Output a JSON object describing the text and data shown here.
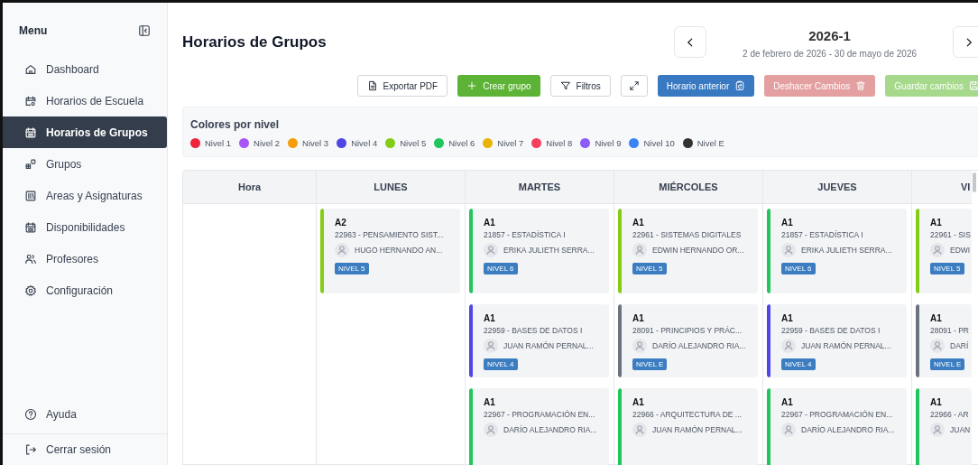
{
  "sidebar": {
    "title": "Menu",
    "items": [
      {
        "label": "Dashboard",
        "selected": false
      },
      {
        "label": "Horarios de Escuela",
        "selected": false
      },
      {
        "label": "Horarios de Grupos",
        "selected": true
      },
      {
        "label": "Grupos",
        "selected": false
      },
      {
        "label": "Areas y Asignaturas",
        "selected": false
      },
      {
        "label": "Disponibilidades",
        "selected": false
      },
      {
        "label": "Profesores",
        "selected": false
      },
      {
        "label": "Configuración",
        "selected": false
      }
    ],
    "footer": [
      {
        "label": "Ayuda"
      },
      {
        "label": "Cerrar sesión"
      }
    ]
  },
  "page": {
    "title": "Horarios de Grupos"
  },
  "period": {
    "name": "2026-1",
    "range": "2 de febrero de 2026 - 30 de mayo de 2026"
  },
  "toolbar": [
    {
      "label": "Exportar PDF",
      "kind": "outline",
      "disabled": false
    },
    {
      "label": "Crear grupo",
      "kind": "green",
      "disabled": false
    },
    {
      "label": "Filtros",
      "kind": "outline",
      "disabled": false
    },
    {
      "kind": "expand",
      "disabled": false
    },
    {
      "label": "Horario anterior",
      "kind": "blue",
      "disabled": false
    },
    {
      "label": "Deshacer Cambios",
      "kind": "red",
      "disabled": true
    },
    {
      "label": "Guardar cambios",
      "kind": "green",
      "disabled": true
    }
  ],
  "legend": {
    "title": "Colores por nivel",
    "items": [
      {
        "label": "Nivel 1",
        "color": "#ef233c"
      },
      {
        "label": "Nivel 2",
        "color": "#a855f7"
      },
      {
        "label": "Nivel 3",
        "color": "#f59e0b"
      },
      {
        "label": "Nivel 4",
        "color": "#4f46e5"
      },
      {
        "label": "Nivel 5",
        "color": "#84cc16"
      },
      {
        "label": "Nivel 6",
        "color": "#22c55e"
      },
      {
        "label": "Nivel 7",
        "color": "#eab308"
      },
      {
        "label": "Nivel 8",
        "color": "#f43f5e"
      },
      {
        "label": "Nivel 9",
        "color": "#8b5cf6"
      },
      {
        "label": "Nivel 10",
        "color": "#3b82f6"
      },
      {
        "label": "Nivel E",
        "color": "#333333"
      }
    ]
  },
  "schedule": {
    "hour_header": "Hora",
    "days": [
      {
        "label": "LUNES",
        "cards": [
          {
            "group": "A2",
            "course": "22963 - PENSAMIENTO SIST...",
            "teacher": "HUGO HERNANDO AN...",
            "badge": "NIVEL 5",
            "color": "#84cc16"
          }
        ]
      },
      {
        "label": "MARTES",
        "cards": [
          {
            "group": "A1",
            "course": "21857 - ESTADÍSTICA I",
            "teacher": "ERIKA JULIETH SERRA...",
            "badge": "NIVEL 6",
            "color": "#22c55e"
          },
          {
            "group": "A1",
            "course": "22959 - BASES DE DATOS I",
            "teacher": "JUAN RAMÓN PERNAL...",
            "badge": "NIVEL 4",
            "color": "#4f46e5"
          },
          {
            "group": "A1",
            "course": "22967 - PROGRAMACIÓN EN...",
            "teacher": "DARÍO ALEJANDRO RIA...",
            "color": "#22c55e"
          }
        ]
      },
      {
        "label": "MIÉRCOLES",
        "cards": [
          {
            "group": "A1",
            "course": "22961 - SISTEMAS DIGITALES",
            "teacher": "EDWIN HERNANDO OR...",
            "badge": "NIVEL 5",
            "color": "#84cc16"
          },
          {
            "group": "A1",
            "course": "28091 - PRINCIPIOS Y PRÁC...",
            "teacher": "DARÍO ALEJANDRO RIA...",
            "badge": "NIVEL E",
            "color": "#6b7280"
          },
          {
            "group": "A1",
            "course": "22966 - ARQUITECTURA DE ...",
            "teacher": "JUAN RAMÓN PERNAL...",
            "color": "#22c55e"
          }
        ]
      },
      {
        "label": "JUEVES",
        "cards": [
          {
            "group": "A1",
            "course": "21857 - ESTADÍSTICA I",
            "teacher": "ERIKA JULIETH SERRA...",
            "badge": "NIVEL 6",
            "color": "#22c55e"
          },
          {
            "group": "A1",
            "course": "22959 - BASES DE DATOS I",
            "teacher": "JUAN RAMÓN PERNAL...",
            "badge": "NIVEL 4",
            "color": "#4f46e5"
          },
          {
            "group": "A1",
            "course": "22967 - PROGRAMACIÓN EN...",
            "teacher": "DARÍO ALEJANDRO RIA...",
            "color": "#22c55e"
          }
        ]
      },
      {
        "label": "VI",
        "cards": [
          {
            "group": "A1",
            "course": "22961 - SIS",
            "teacher": "EDWI",
            "badge": "NIVEL 5",
            "color": "#84cc16"
          },
          {
            "group": "A1",
            "course": "28091 - PR",
            "teacher": "DARÍ",
            "badge": "NIVEL E",
            "color": "#6b7280"
          },
          {
            "group": "A1",
            "course": "22966 - AR",
            "teacher": "JUAN",
            "color": "#22c55e"
          }
        ]
      }
    ]
  }
}
